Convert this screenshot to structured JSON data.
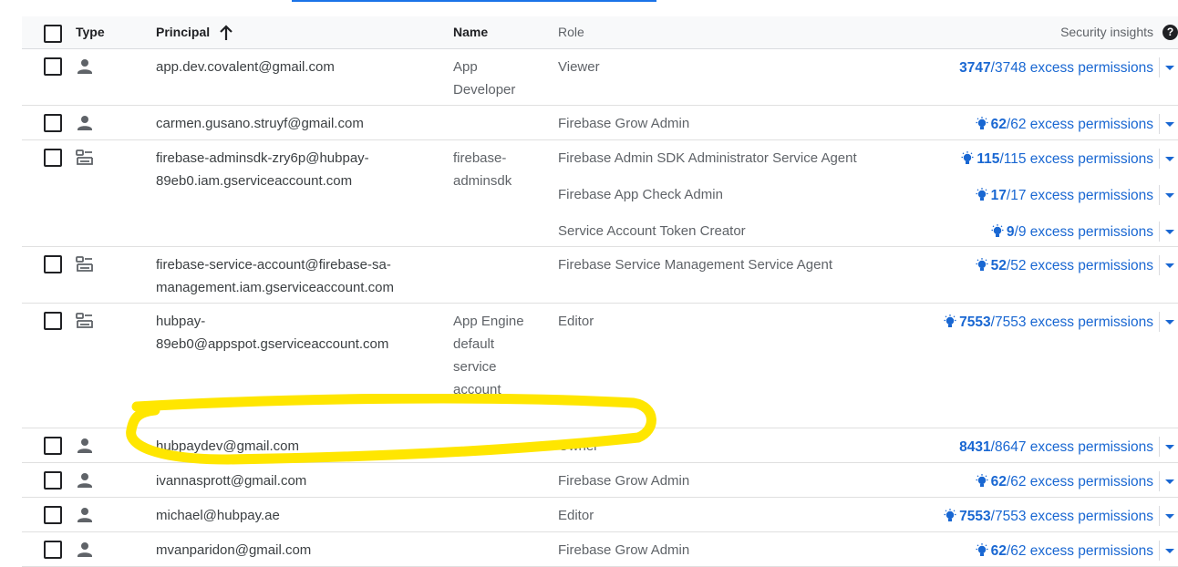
{
  "header": {
    "type": "Type",
    "principal": "Principal",
    "name": "Name",
    "role": "Role",
    "security_insights": "Security insights"
  },
  "rows": [
    {
      "type_icon": "person-icon",
      "principal": "app.dev.covalent@gmail.com",
      "name": "App Developer",
      "roles": [
        {
          "role": "Viewer",
          "bulb": false,
          "excess": "3747",
          "total": "3748",
          "suffix": " excess permissions"
        }
      ]
    },
    {
      "type_icon": "person-icon",
      "principal": "carmen.gusano.struyf@gmail.com",
      "name": "",
      "roles": [
        {
          "role": "Firebase Grow Admin",
          "bulb": true,
          "excess": "62",
          "total": "62",
          "suffix": " excess permissions"
        }
      ]
    },
    {
      "type_icon": "service-account-icon",
      "principal": "firebase-adminsdk-zry6p@hubpay-89eb0.iam.gserviceaccount.com",
      "name": "firebase-adminsdk",
      "roles": [
        {
          "role": "Firebase Admin SDK Administrator Service Agent",
          "bulb": true,
          "excess": "115",
          "total": "115",
          "suffix": " excess permissions"
        },
        {
          "role": "Firebase App Check Admin",
          "bulb": true,
          "excess": "17",
          "total": "17",
          "suffix": " excess permissions"
        },
        {
          "role": "Service Account Token Creator",
          "bulb": true,
          "excess": "9",
          "total": "9",
          "suffix": " excess permissions"
        }
      ]
    },
    {
      "type_icon": "service-account-icon",
      "principal": "firebase-service-account@firebase-sa-management.iam.gserviceaccount.com",
      "name": "",
      "roles": [
        {
          "role": "Firebase Service Management Service Agent",
          "bulb": true,
          "excess": "52",
          "total": "52",
          "suffix": " excess permissions"
        }
      ]
    },
    {
      "type_icon": "service-account-icon",
      "principal": "hubpay-89eb0@appspot.gserviceaccount.com",
      "name": "App Engine default service account",
      "roles": [
        {
          "role": "Editor",
          "bulb": true,
          "excess": "7553",
          "total": "7553",
          "suffix": " excess permissions"
        }
      ]
    },
    {
      "type_icon": "person-icon",
      "principal": "hubpaydev@gmail.com",
      "name": "",
      "roles": [
        {
          "role": "Owner",
          "bulb": false,
          "excess": "8431",
          "total": "8647",
          "suffix": " excess permissions"
        }
      ]
    },
    {
      "type_icon": "person-icon",
      "principal": "ivannasprott@gmail.com",
      "name": "",
      "roles": [
        {
          "role": "Firebase Grow Admin",
          "bulb": true,
          "excess": "62",
          "total": "62",
          "suffix": " excess permissions"
        }
      ]
    },
    {
      "type_icon": "person-icon",
      "principal": "michael@hubpay.ae",
      "name": "",
      "roles": [
        {
          "role": "Editor",
          "bulb": true,
          "excess": "7553",
          "total": "7553",
          "suffix": " excess permissions"
        }
      ]
    },
    {
      "type_icon": "person-icon",
      "principal": "mvanparidon@gmail.com",
      "name": "",
      "roles": [
        {
          "role": "Firebase Grow Admin",
          "bulb": true,
          "excess": "62",
          "total": "62",
          "suffix": " excess permissions"
        }
      ]
    }
  ],
  "colors": {
    "link": "#1967d2",
    "highlight": "#ffe600"
  }
}
